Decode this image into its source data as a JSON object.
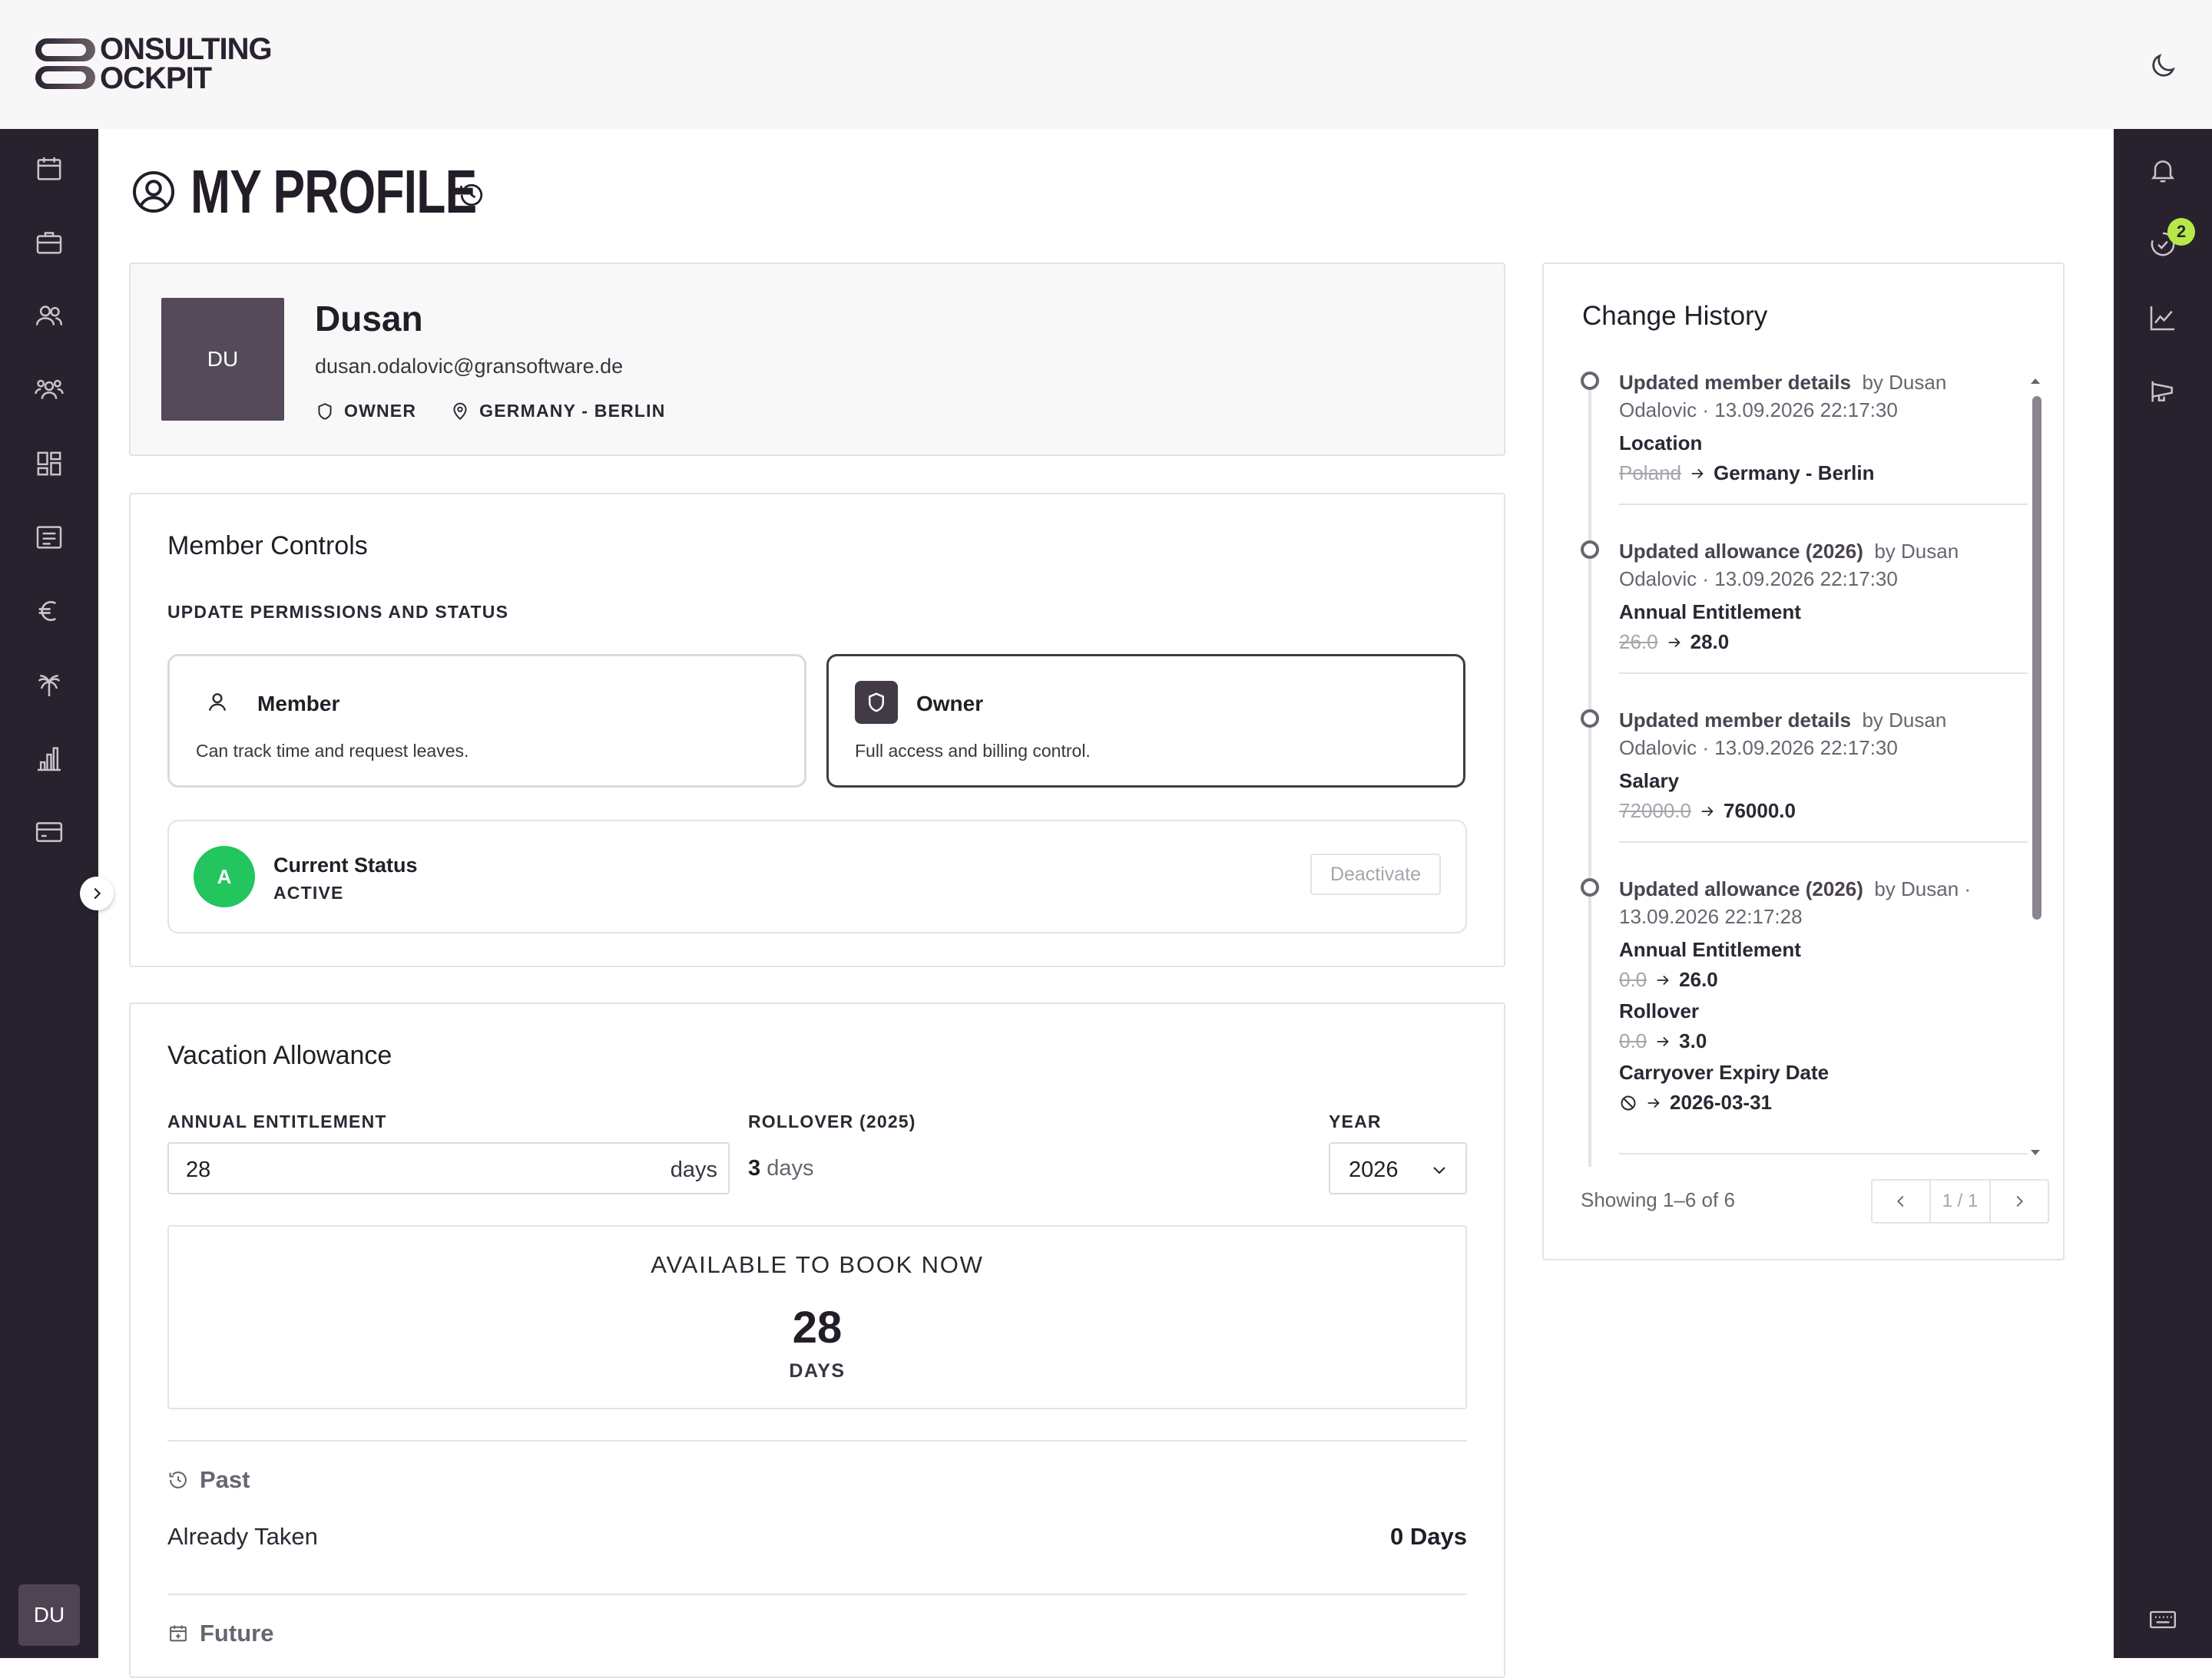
{
  "app": {
    "logo_line1": "ONSULTING",
    "logo_line2": "OCKPIT",
    "user_initials": "DU",
    "notification_count": "2"
  },
  "page": {
    "title": "MY PROFILE"
  },
  "profile": {
    "initials": "DU",
    "name": "Dusan",
    "email": "dusan.odalovic@gransoftware.de",
    "role": "OWNER",
    "location": "GERMANY - BERLIN"
  },
  "member_controls": {
    "title": "Member Controls",
    "subtitle": "UPDATE PERMISSIONS AND STATUS",
    "roles": [
      {
        "label": "Member",
        "description": "Can track time and request leaves.",
        "selected": false
      },
      {
        "label": "Owner",
        "description": "Full access and billing control.",
        "selected": true
      }
    ],
    "status": {
      "avatar_letter": "A",
      "label": "Current Status",
      "value": "ACTIVE",
      "action_label": "Deactivate"
    }
  },
  "vacation": {
    "title": "Vacation Allowance",
    "annual_label": "ANNUAL ENTITLEMENT",
    "annual_value": "28",
    "annual_unit": "days",
    "rollover_label": "ROLLOVER (2025)",
    "rollover_value": "3",
    "rollover_unit": "days",
    "year_label": "YEAR",
    "year_value": "2026",
    "available_label": "AVAILABLE TO BOOK NOW",
    "available_value": "28",
    "available_unit": "DAYS",
    "past_label": "Past",
    "already_taken_label": "Already Taken",
    "already_taken_value": "0 Days",
    "future_label": "Future"
  },
  "history": {
    "title": "Change History",
    "items": [
      {
        "action": "Updated member details",
        "by_line1": "by Dusan",
        "by_line2": "Odalovic · 13.09.2026 22:17:30",
        "changes": [
          {
            "field": "Location",
            "old": "Poland",
            "new": "Germany - Berlin"
          }
        ]
      },
      {
        "action": "Updated allowance (2026)",
        "by_line1": "by Dusan",
        "by_line2": "Odalovic · 13.09.2026 22:17:30",
        "changes": [
          {
            "field": "Annual Entitlement",
            "old": "26.0",
            "new": "28.0"
          }
        ]
      },
      {
        "action": "Updated member details",
        "by_line1": "by Dusan",
        "by_line2": "Odalovic · 13.09.2026 22:17:30",
        "changes": [
          {
            "field": "Salary",
            "old": "72000.0",
            "new": "76000.0"
          }
        ]
      },
      {
        "action": "Updated allowance (2026)",
        "by_line1": "by Dusan ·",
        "by_line2": "13.09.2026 22:17:28",
        "changes": [
          {
            "field": "Annual Entitlement",
            "old": "0.0",
            "new": "26.0"
          },
          {
            "field": "Rollover",
            "old": "0.0",
            "new": "3.0"
          },
          {
            "field": "Carryover Expiry Date",
            "old": "",
            "new": "2026-03-31"
          }
        ]
      }
    ],
    "showing": "Showing 1–6 of 6",
    "page_indicator": "1 / 1"
  },
  "colors": {
    "sidebar": "#28222f",
    "accent_badge": "#b6e84a",
    "status_active": "#22c55e",
    "avatar": "#4e4453"
  }
}
